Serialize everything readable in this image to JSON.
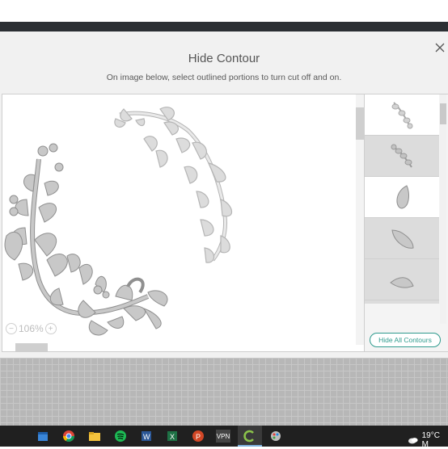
{
  "dialog": {
    "title": "Hide Contour",
    "subtitle": "On image below, select outlined portions to turn cut off and on.",
    "zoom_level": "106%",
    "hide_all_label": "Hide All Contours"
  },
  "thumbnails": [
    {
      "name": "thumb-small-vine",
      "selected": false
    },
    {
      "name": "thumb-vine-cluster",
      "selected": false
    },
    {
      "name": "thumb-leaf-1",
      "selected": true
    },
    {
      "name": "thumb-leaf-2",
      "selected": false
    },
    {
      "name": "thumb-leaf-3",
      "selected": false
    },
    {
      "name": "thumb-heart-leaf",
      "selected": false
    }
  ],
  "taskbar": {
    "icons": [
      "calendar-icon",
      "chrome-icon",
      "file-explorer-icon",
      "spotify-icon",
      "word-icon",
      "excel-icon",
      "powerpoint-icon",
      "vpn-icon",
      "cricut-icon",
      "paint-icon"
    ],
    "vpn_label": "VPN",
    "weather_text": "19°C M"
  },
  "colors": {
    "accent": "#2f9b8e",
    "taskbar": "#202020",
    "cut_fill": "#c8c8c8"
  }
}
